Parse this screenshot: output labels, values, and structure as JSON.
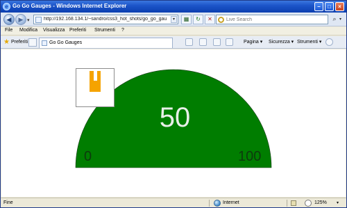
{
  "window": {
    "title": "Go Go Gauges - Windows Internet Explorer"
  },
  "address_bar": {
    "url": "http://192.168.134.1/~sandro/css3_hot_shots/go_go_gau",
    "search_placeholder": "Live Search"
  },
  "menu": {
    "items": [
      "File",
      "Modifica",
      "Visualizza",
      "Preferiti",
      "Strumenti",
      "?"
    ]
  },
  "favorites_bar": {
    "favorites_label": "Preferiti",
    "tab_label": "Go Go Gauges",
    "commands": [
      "Pagina ▾",
      "Sicurezza ▾",
      "Strumenti ▾"
    ]
  },
  "gauge": {
    "value": "50",
    "min_label": "0",
    "max_label": "100",
    "fill_color": "#007d00",
    "needle_color": "#f5a300"
  },
  "status_bar": {
    "status": "Fine",
    "zone": "Internet",
    "zoom": "125%"
  },
  "colors": {
    "title_bar": "#1d55c9",
    "chrome": "#ece9d8"
  }
}
